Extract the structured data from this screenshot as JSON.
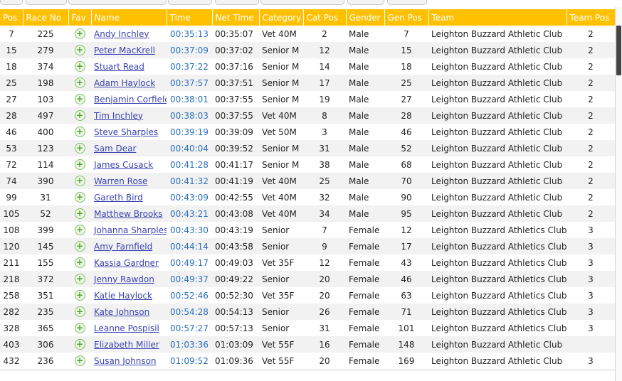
{
  "columns": {
    "pos": "Pos",
    "race_no": "Race No",
    "fav": "Fav",
    "name": "Name",
    "time": "Time",
    "net_time": "Net Time",
    "category": "Category",
    "cat_pos": "Cat Pos",
    "gender": "Gender",
    "gen_pos": "Gen Pos",
    "team": "Team",
    "team_pos": "Team Pos"
  },
  "fav_icon": "plus-circle-icon",
  "colors": {
    "header_bg": "#ffc000",
    "link": "#3a44b0",
    "time_link": "#2a6fbf",
    "fav_green": "#4ca32a"
  },
  "rows": [
    {
      "pos": "7",
      "race_no": "225",
      "name": "Andy Inchley",
      "time": "00:35:13",
      "net_time": "00:35:07",
      "category": "Vet 40M",
      "cat_pos": "2",
      "gender": "Male",
      "gen_pos": "7",
      "team": "Leighton Buzzard Athletic Club",
      "team_pos": "2"
    },
    {
      "pos": "15",
      "race_no": "279",
      "name": "Peter MacKrell",
      "time": "00:37:09",
      "net_time": "00:37:02",
      "category": "Senior M",
      "cat_pos": "12",
      "gender": "Male",
      "gen_pos": "15",
      "team": "Leighton Buzzard Athletic Club",
      "team_pos": "2"
    },
    {
      "pos": "18",
      "race_no": "374",
      "name": "Stuart Read",
      "time": "00:37:22",
      "net_time": "00:37:16",
      "category": "Senior M",
      "cat_pos": "14",
      "gender": "Male",
      "gen_pos": "18",
      "team": "Leighton Buzzard Athletic Club",
      "team_pos": "2"
    },
    {
      "pos": "25",
      "race_no": "198",
      "name": "Adam Haylock",
      "time": "00:37:57",
      "net_time": "00:37:51",
      "category": "Senior M",
      "cat_pos": "17",
      "gender": "Male",
      "gen_pos": "25",
      "team": "Leighton Buzzard Athletic Club",
      "team_pos": "2"
    },
    {
      "pos": "27",
      "race_no": "103",
      "name": "Benjamin Corfield",
      "time": "00:38:01",
      "net_time": "00:37:55",
      "category": "Senior M",
      "cat_pos": "19",
      "gender": "Male",
      "gen_pos": "27",
      "team": "Leighton Buzzard Athletic Club",
      "team_pos": "2"
    },
    {
      "pos": "28",
      "race_no": "497",
      "name": "Tim Inchley",
      "time": "00:38:03",
      "net_time": "00:37:55",
      "category": "Vet 40M",
      "cat_pos": "8",
      "gender": "Male",
      "gen_pos": "28",
      "team": "Leighton Buzzard Athletic Club",
      "team_pos": "2"
    },
    {
      "pos": "46",
      "race_no": "400",
      "name": "Steve Sharples",
      "time": "00:39:19",
      "net_time": "00:39:09",
      "category": "Vet 50M",
      "cat_pos": "3",
      "gender": "Male",
      "gen_pos": "46",
      "team": "Leighton Buzzard Athletic Club",
      "team_pos": "2"
    },
    {
      "pos": "53",
      "race_no": "123",
      "name": "Sam Dear",
      "time": "00:40:04",
      "net_time": "00:39:52",
      "category": "Senior M",
      "cat_pos": "31",
      "gender": "Male",
      "gen_pos": "52",
      "team": "Leighton Buzzard Athletic Club",
      "team_pos": "2"
    },
    {
      "pos": "72",
      "race_no": "114",
      "name": "James Cusack",
      "time": "00:41:28",
      "net_time": "00:41:17",
      "category": "Senior M",
      "cat_pos": "38",
      "gender": "Male",
      "gen_pos": "68",
      "team": "Leighton Buzzard Athletic Club",
      "team_pos": "2"
    },
    {
      "pos": "74",
      "race_no": "390",
      "name": "Warren Rose",
      "time": "00:41:32",
      "net_time": "00:41:19",
      "category": "Vet 40M",
      "cat_pos": "25",
      "gender": "Male",
      "gen_pos": "70",
      "team": "Leighton Buzzard Athletic Club",
      "team_pos": "2"
    },
    {
      "pos": "99",
      "race_no": "31",
      "name": "Gareth Bird",
      "time": "00:43:09",
      "net_time": "00:42:55",
      "category": "Vet 40M",
      "cat_pos": "32",
      "gender": "Male",
      "gen_pos": "90",
      "team": "Leighton Buzzard Athletic Club",
      "team_pos": "2"
    },
    {
      "pos": "105",
      "race_no": "52",
      "name": "Matthew Brooks",
      "time": "00:43:21",
      "net_time": "00:43:08",
      "category": "Vet 40M",
      "cat_pos": "34",
      "gender": "Male",
      "gen_pos": "95",
      "team": "Leighton Buzzard Athletic Club",
      "team_pos": "2"
    },
    {
      "pos": "108",
      "race_no": "399",
      "name": "Johanna Sharples",
      "time": "00:43:30",
      "net_time": "00:43:19",
      "category": "Senior",
      "cat_pos": "7",
      "gender": "Female",
      "gen_pos": "12",
      "team": "Leighton Buzzard Athletics Club",
      "team_pos": "3"
    },
    {
      "pos": "120",
      "race_no": "145",
      "name": "Amy Farnfield",
      "time": "00:44:14",
      "net_time": "00:43:58",
      "category": "Senior",
      "cat_pos": "9",
      "gender": "Female",
      "gen_pos": "17",
      "team": "Leighton Buzzard Athletics Club",
      "team_pos": "3"
    },
    {
      "pos": "211",
      "race_no": "155",
      "name": "Kassia Gardner",
      "time": "00:49:17",
      "net_time": "00:49:03",
      "category": "Vet 35F",
      "cat_pos": "12",
      "gender": "Female",
      "gen_pos": "43",
      "team": "Leighton Buzzard Athletics Club",
      "team_pos": "3"
    },
    {
      "pos": "218",
      "race_no": "372",
      "name": "Jenny Rawdon",
      "time": "00:49:37",
      "net_time": "00:49:22",
      "category": "Senior",
      "cat_pos": "20",
      "gender": "Female",
      "gen_pos": "46",
      "team": "Leighton Buzzard Athletics Club",
      "team_pos": "3"
    },
    {
      "pos": "258",
      "race_no": "351",
      "name": "Katie Haylock",
      "time": "00:52:46",
      "net_time": "00:52:30",
      "category": "Vet 35F",
      "cat_pos": "20",
      "gender": "Female",
      "gen_pos": "63",
      "team": "Leighton Buzzard Athletics Club",
      "team_pos": "3"
    },
    {
      "pos": "282",
      "race_no": "235",
      "name": "Kate Johnson",
      "time": "00:54:28",
      "net_time": "00:54:13",
      "category": "Senior",
      "cat_pos": "26",
      "gender": "Female",
      "gen_pos": "71",
      "team": "Leighton Buzzard Athletics Club",
      "team_pos": "3"
    },
    {
      "pos": "328",
      "race_no": "365",
      "name": "Leanne Pospisil",
      "time": "00:57:27",
      "net_time": "00:57:13",
      "category": "Senior",
      "cat_pos": "31",
      "gender": "Female",
      "gen_pos": "101",
      "team": "Leighton Buzzard Athletics Club",
      "team_pos": "3"
    },
    {
      "pos": "403",
      "race_no": "306",
      "name": "Elizabeth Miller",
      "time": "01:03:36",
      "net_time": "01:03:09",
      "category": "Vet 55F",
      "cat_pos": "16",
      "gender": "Female",
      "gen_pos": "148",
      "team": "Leighton Buzzard Athletic Club",
      "team_pos": ""
    },
    {
      "pos": "432",
      "race_no": "236",
      "name": "Susan Johnson",
      "time": "01:09:52",
      "net_time": "01:09:36",
      "category": "Vet 55F",
      "cat_pos": "20",
      "gender": "Female",
      "gen_pos": "169",
      "team": "Leighton Buzzard Athletic Club",
      "team_pos": "3"
    }
  ]
}
